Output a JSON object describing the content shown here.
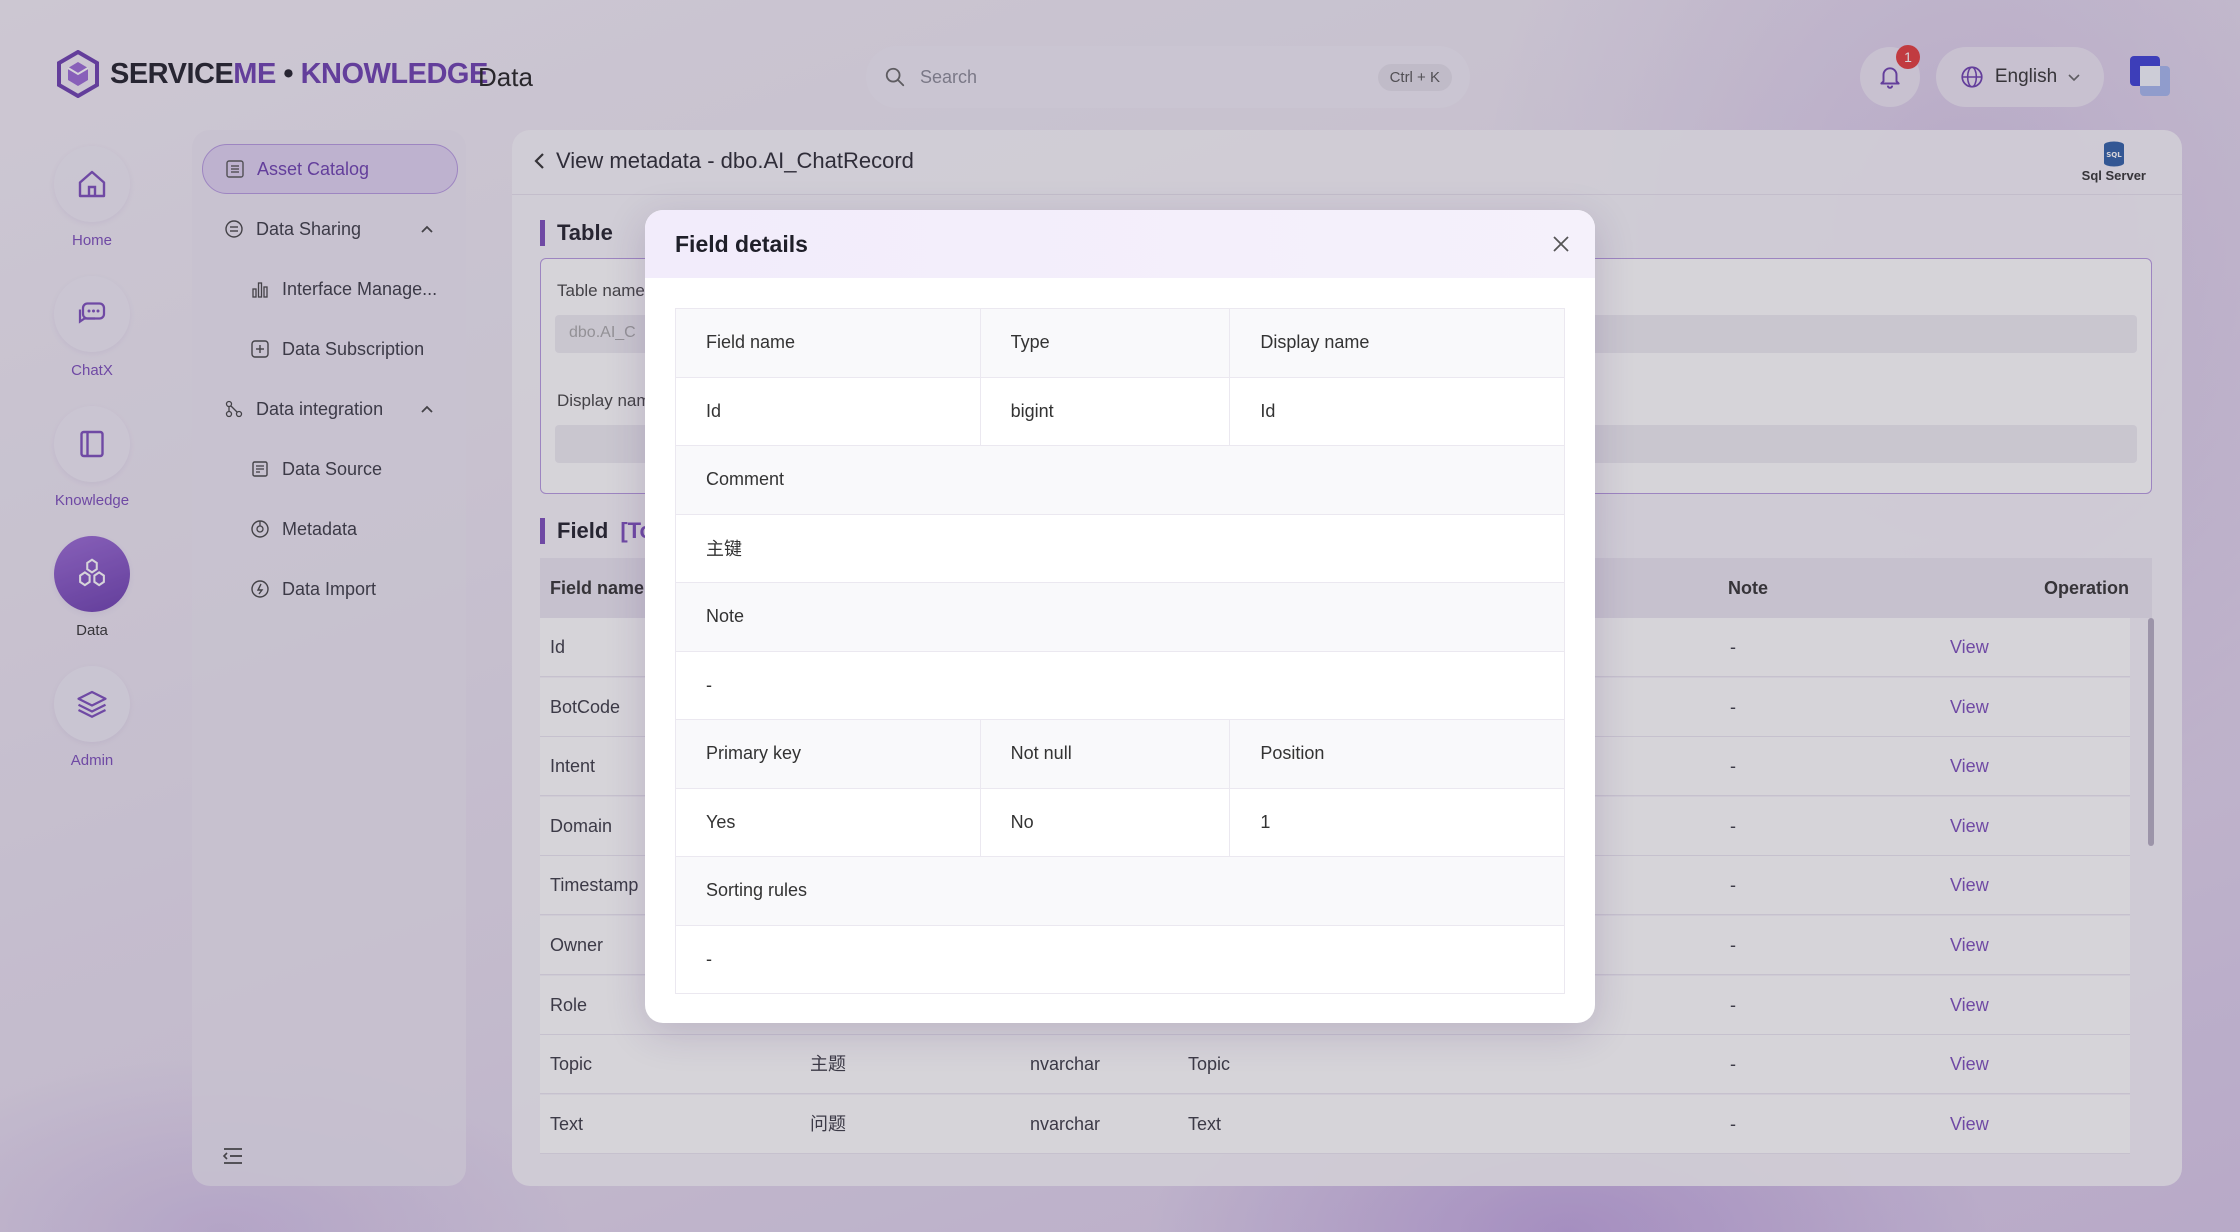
{
  "header": {
    "logo_left": "SERVICE",
    "logo_me": "ME",
    "logo_dot": " • ",
    "logo_knowledge": "KNOWLEDGE",
    "module_title": "Data",
    "search_placeholder": "Search",
    "search_shortcut": "Ctrl + K",
    "notification_count": "1",
    "language": "English"
  },
  "rail": {
    "items": [
      {
        "label": "Home",
        "icon": "home-icon"
      },
      {
        "label": "ChatX",
        "icon": "chat-icon"
      },
      {
        "label": "Knowledge",
        "icon": "book-icon"
      },
      {
        "label": "Data",
        "icon": "hexagon-cluster-icon"
      },
      {
        "label": "Admin",
        "icon": "layers-icon"
      }
    ]
  },
  "subnav": {
    "asset_catalog": "Asset Catalog",
    "data_sharing": "Data Sharing",
    "interface_manage": "Interface Manage...",
    "data_subscription": "Data Subscription",
    "data_integration": "Data integration",
    "data_source": "Data Source",
    "metadata": "Metadata",
    "data_import": "Data Import"
  },
  "main": {
    "page_title": "View metadata - dbo.AI_ChatRecord",
    "db_type": "Sql Server",
    "db_icon_text": "SQL",
    "table_section": "Table",
    "table_name_label": "Table name",
    "table_name_value": "dbo.AI_C",
    "display_name_label": "Display nam",
    "field_section": "Field",
    "field_tag": "[To",
    "columns": {
      "field_name": "Field name",
      "note": "Note",
      "operation": "Operation"
    },
    "rows": [
      {
        "field": "Id",
        "cn": "",
        "type": "",
        "display": "",
        "note": "-",
        "op": "View"
      },
      {
        "field": "BotCode",
        "cn": "",
        "type": "",
        "display": "",
        "note": "-",
        "op": "View"
      },
      {
        "field": "Intent",
        "cn": "",
        "type": "",
        "display": "",
        "note": "-",
        "op": "View"
      },
      {
        "field": "Domain",
        "cn": "",
        "type": "",
        "display": "",
        "note": "-",
        "op": "View"
      },
      {
        "field": "Timestamp",
        "cn": "",
        "type": "",
        "display": "",
        "note": "-",
        "op": "View"
      },
      {
        "field": "Owner",
        "cn": "",
        "type": "",
        "display": "",
        "note": "-",
        "op": "View"
      },
      {
        "field": "Role",
        "cn": "",
        "type": "",
        "display": "",
        "note": "-",
        "op": "View"
      },
      {
        "field": "Topic",
        "cn": "主题",
        "type": "nvarchar",
        "display": "Topic",
        "note": "-",
        "op": "View"
      },
      {
        "field": "Text",
        "cn": "问题",
        "type": "nvarchar",
        "display": "Text",
        "note": "-",
        "op": "View"
      }
    ]
  },
  "modal": {
    "title": "Field details",
    "labels": {
      "field_name": "Field name",
      "type": "Type",
      "display_name": "Display name",
      "comment": "Comment",
      "note": "Note",
      "primary_key": "Primary key",
      "not_null": "Not null",
      "position": "Position",
      "sorting_rules": "Sorting rules"
    },
    "values": {
      "field_name": "Id",
      "type": "bigint",
      "display_name": "Id",
      "comment": "主键",
      "note": "-",
      "primary_key": "Yes",
      "not_null": "No",
      "position": "1",
      "sorting_rules": "-"
    }
  },
  "colors": {
    "accent": "#7b4dbb",
    "badge": "#e53c3c"
  }
}
